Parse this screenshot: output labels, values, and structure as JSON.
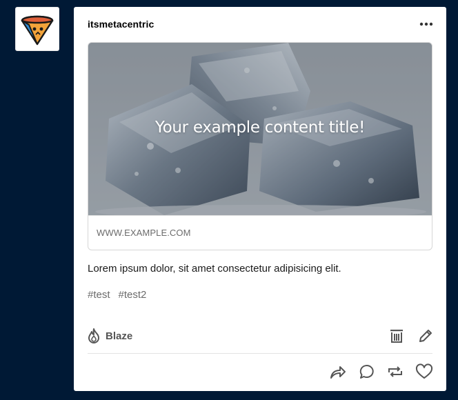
{
  "post": {
    "username": "itsmetacentric",
    "link": {
      "title": "Your example content title!",
      "url": "WWW.EXAMPLE.COM"
    },
    "body": "Lorem ipsum dolor, sit amet consectetur adipisicing elit.",
    "tags": [
      "#test",
      "#test2"
    ],
    "blaze_label": "Blaze"
  },
  "colors": {
    "page_background": "#001935",
    "avatar_accent": "#e0603a",
    "avatar_secondary": "#2e8bd3"
  },
  "icons": [
    "more-icon",
    "blaze-icon",
    "delete-icon",
    "edit-icon",
    "share-icon",
    "reply-icon",
    "reblog-icon",
    "like-icon"
  ]
}
